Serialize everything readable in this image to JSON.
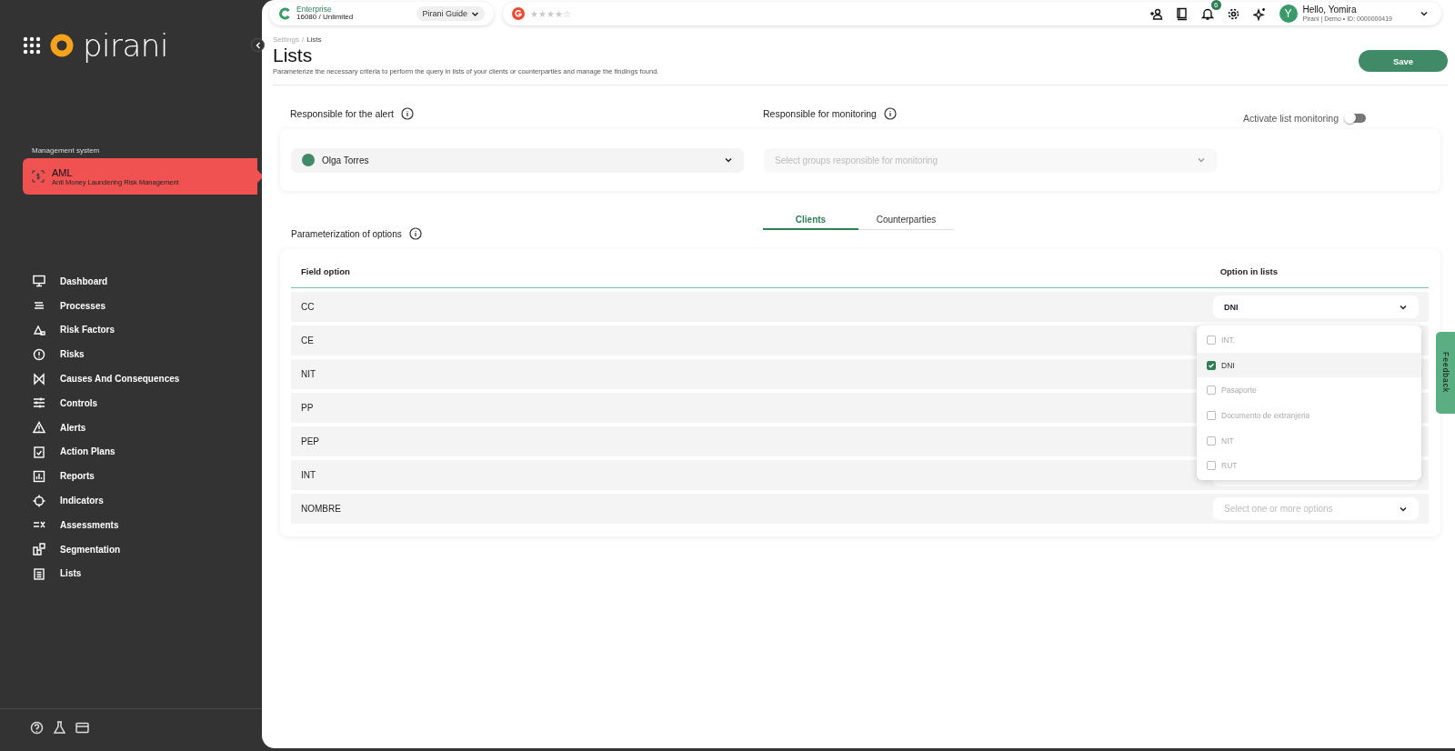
{
  "sidebar": {
    "logo_text": "pirani",
    "section_label": "Management system",
    "module": {
      "title": "AML",
      "subtitle": "Anti Money Laundering Risk Management"
    },
    "items": [
      {
        "label": "Dashboard"
      },
      {
        "label": "Processes"
      },
      {
        "label": "Risk Factors"
      },
      {
        "label": "Risks"
      },
      {
        "label": "Causes And Consequences"
      },
      {
        "label": "Controls"
      },
      {
        "label": "Alerts"
      },
      {
        "label": "Action Plans"
      },
      {
        "label": "Reports"
      },
      {
        "label": "Indicators"
      },
      {
        "label": "Assessments"
      },
      {
        "label": "Segmentation"
      },
      {
        "label": "Lists"
      }
    ]
  },
  "topbar": {
    "plan": "Enterprise",
    "usage": "16080 / Unlimited",
    "guide": "Pirani Guide",
    "stars": 4,
    "notifications": "6",
    "avatar_letter": "Y",
    "greeting": "Hello, Yomira",
    "account": "Pirani | Demo • ID: 0000000419"
  },
  "page": {
    "breadcrumb_parent": "Settings",
    "breadcrumb_separator": "/",
    "breadcrumb_current": "Lists",
    "title": "Lists",
    "description": "Parameterize the necessary criteria to perform the query in lists of your clients or counterparties and manage the findings found.",
    "save": "Save"
  },
  "responsible": {
    "alert_label": "Responsible for the alert",
    "alert_value": "Olga Torres",
    "monitoring_label": "Responsible for monitoring",
    "monitoring_placeholder": "Select groups responsible for monitoring",
    "activate_label": "Activate list monitoring",
    "activate_on": false
  },
  "tabs": [
    {
      "label": "Clients",
      "selected": true
    },
    {
      "label": "Counterparties",
      "selected": false
    }
  ],
  "options": {
    "title": "Parameterization of options",
    "columns": [
      "Field option",
      "Option in lists"
    ],
    "rows": [
      {
        "field": "CC",
        "value": "DNI"
      },
      {
        "field": "CE"
      },
      {
        "field": "NIT"
      },
      {
        "field": "PP"
      },
      {
        "field": "PEP"
      },
      {
        "field": "INT"
      },
      {
        "field": "NOMBRE",
        "placeholder": "Select one or more options"
      }
    ]
  },
  "dropdown": [
    {
      "label": "INT.",
      "checked": false
    },
    {
      "label": "DNI",
      "checked": true
    },
    {
      "label": "Pasaporte",
      "checked": false
    },
    {
      "label": "Documento de extranjeria",
      "checked": false
    },
    {
      "label": "NIT",
      "checked": false
    },
    {
      "label": "RUT",
      "checked": false
    }
  ],
  "feedback": "Feedback"
}
